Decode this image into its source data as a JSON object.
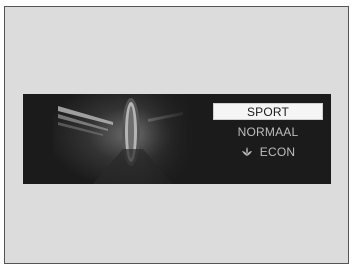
{
  "drive_mode_menu": {
    "items": [
      {
        "label": "SPORT",
        "selected": true
      },
      {
        "label": "NORMAAL",
        "selected": false
      },
      {
        "label": "ECON",
        "selected": false,
        "icon": "leaf-icon"
      }
    ]
  }
}
